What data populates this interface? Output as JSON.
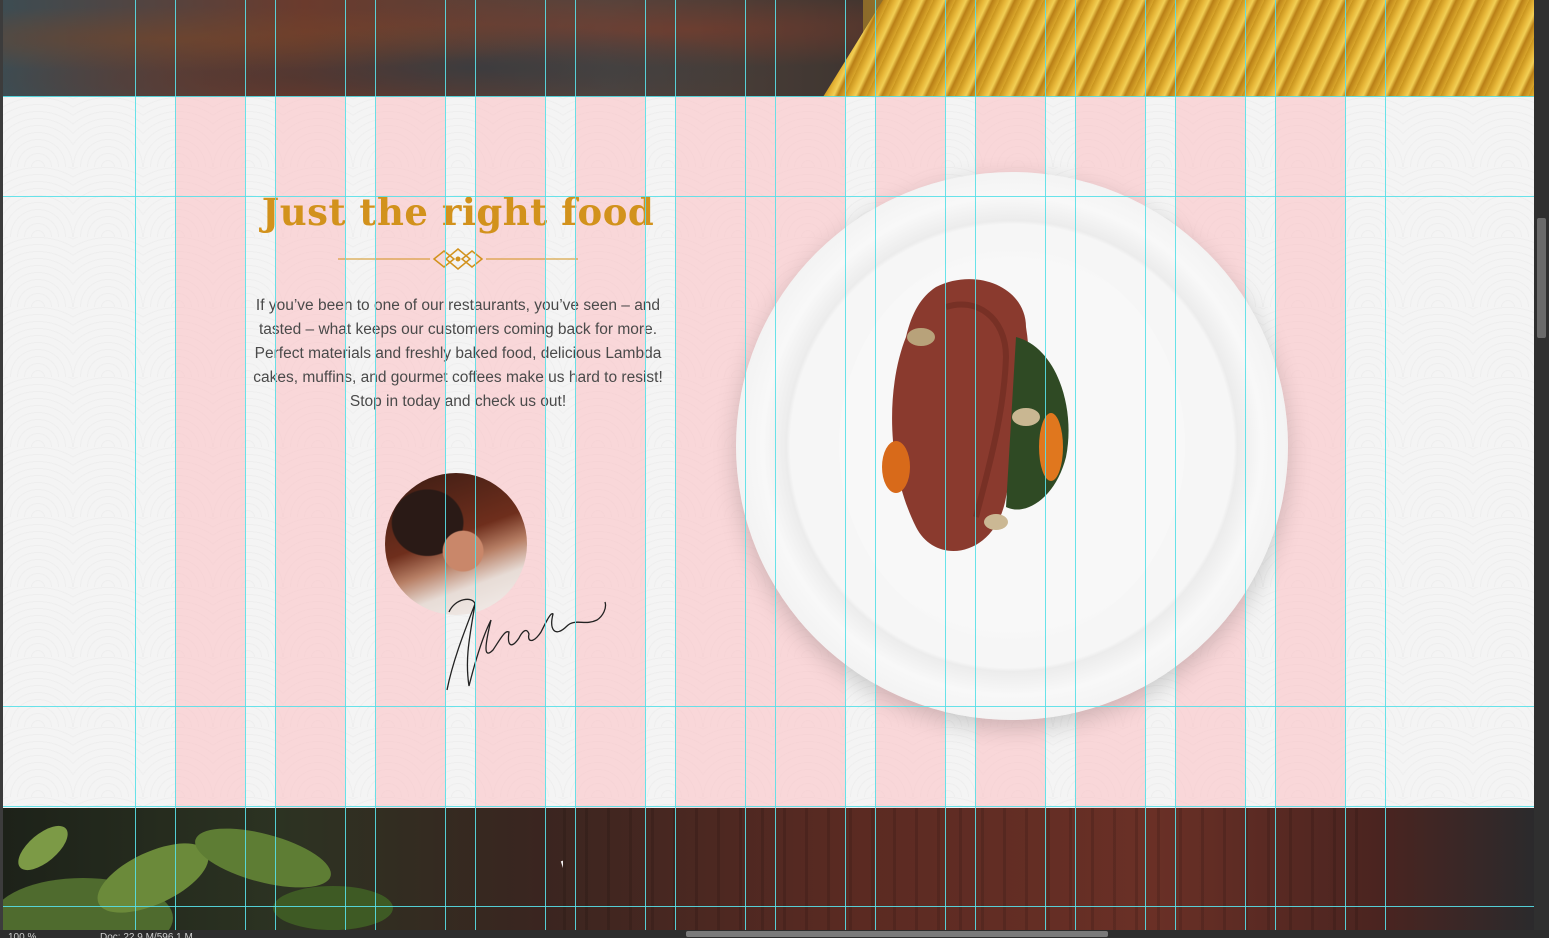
{
  "section": {
    "headline": "Just the right food",
    "intro": "If you’ve been to one of our restaurants, you’ve seen – and tasted – what keeps our customers coming back for more. Perfect materials and freshly baked food, delicious Lambda cakes,  muffins, and gourmet coffees make us hard to resist! Stop in today and check us out!"
  },
  "icons": {
    "ornament": "divider-ornament-icon",
    "avatar": "chef-avatar",
    "signature": "signature",
    "plate": "plate-with-steak"
  },
  "colors": {
    "headline": "#d2921c",
    "body_text": "#4a4a4a",
    "guides": "#58e0e8",
    "grid_columns": "#ffb4b9"
  },
  "status": {
    "zoom": "100 %",
    "doc_size": "Doc: 22.9 M/596.1 M"
  }
}
